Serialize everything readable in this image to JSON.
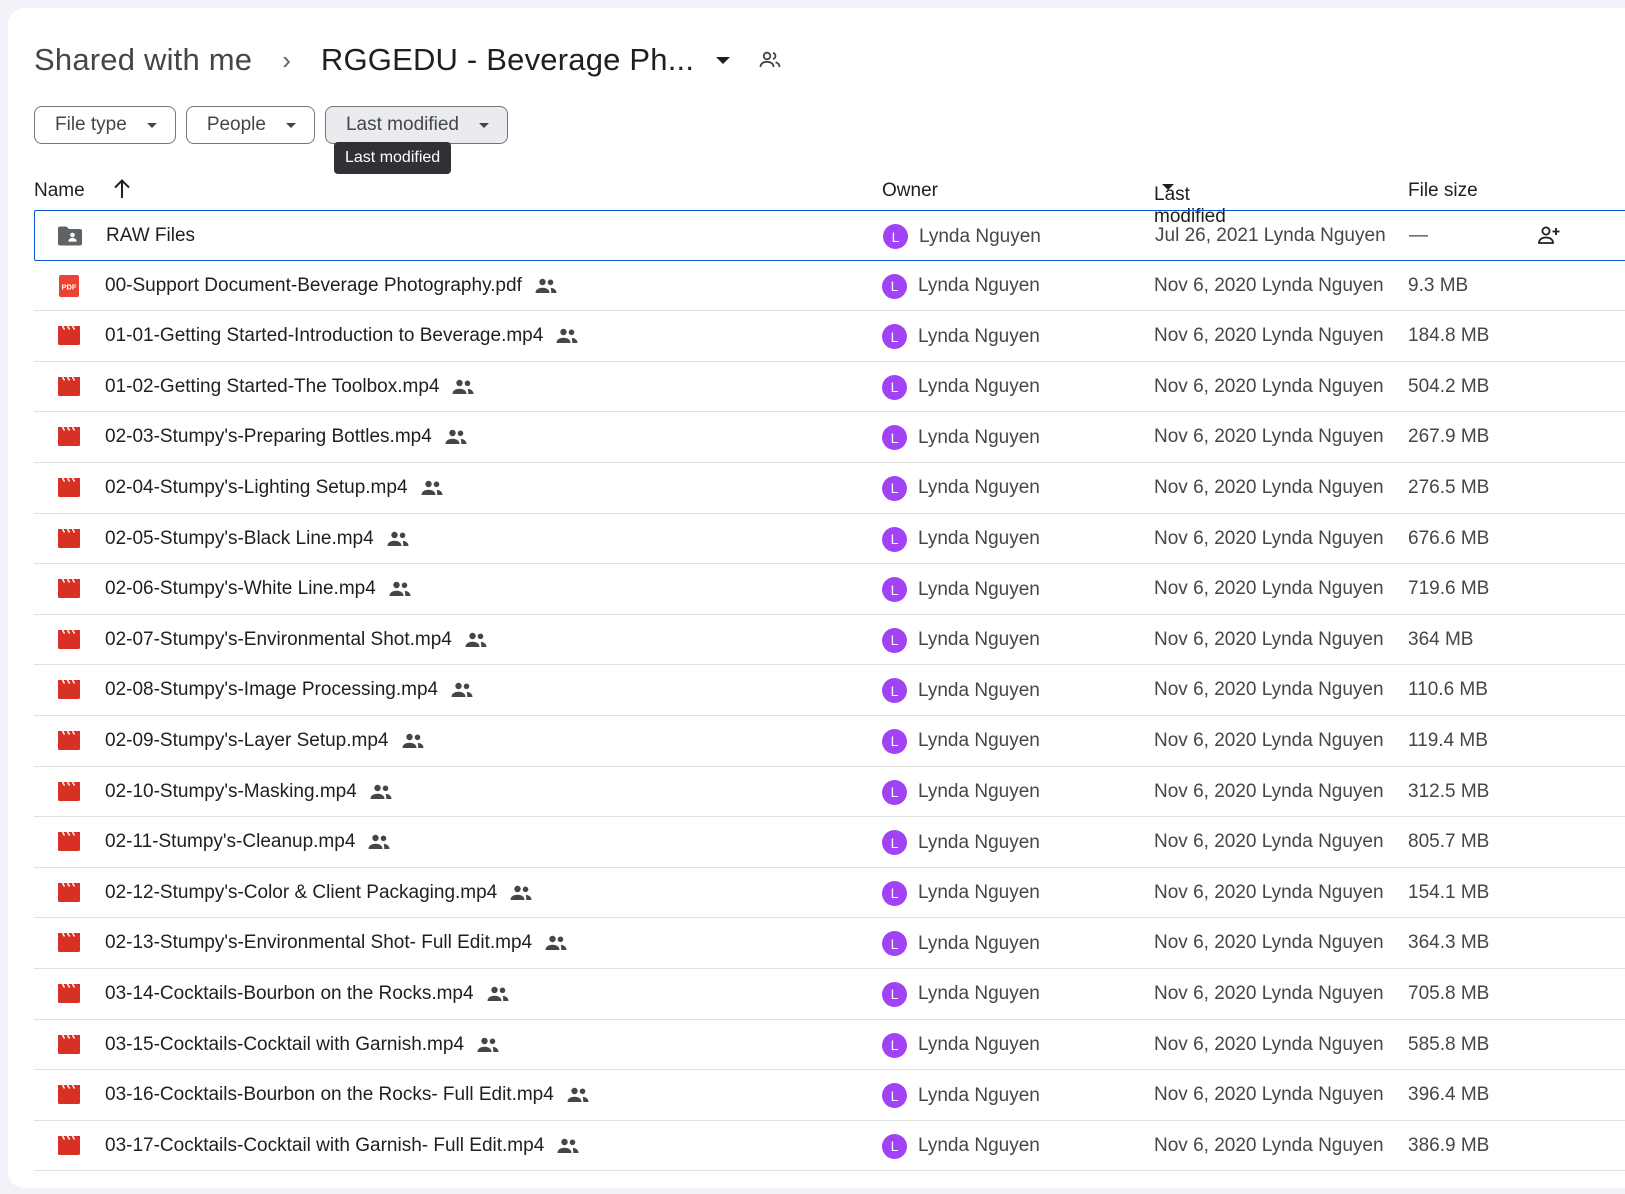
{
  "breadcrumb": {
    "root": "Shared with me",
    "separator": "›",
    "current": "RGGEDU - Beverage Ph..."
  },
  "filters": {
    "file_type": "File type",
    "people": "People",
    "last_modified": "Last modified"
  },
  "tooltip": "Last modified",
  "columns": {
    "name": "Name",
    "owner": "Owner",
    "last_modified": "Last modified",
    "file_size": "File size"
  },
  "colors": {
    "accent": "#0b57d0",
    "avatar": "#a142f4",
    "video": "#d93025",
    "pdf": "#ea4335"
  },
  "files": [
    {
      "name": "RAW Files",
      "type": "folder-icon",
      "shared": false,
      "owner": "Lynda Nguyen",
      "avatar": "L",
      "modified": "Jul 26, 2021 Lynda Nguyen",
      "size": "—",
      "selected": true
    },
    {
      "name": "00-Support Document-Beverage Photography.pdf",
      "type": "pdf-icon",
      "shared": true,
      "owner": "Lynda Nguyen",
      "avatar": "L",
      "modified": "Nov 6, 2020 Lynda Nguyen",
      "size": "9.3 MB"
    },
    {
      "name": "01-01-Getting Started-Introduction to Beverage.mp4",
      "type": "video-icon",
      "shared": true,
      "owner": "Lynda Nguyen",
      "avatar": "L",
      "modified": "Nov 6, 2020 Lynda Nguyen",
      "size": "184.8 MB"
    },
    {
      "name": "01-02-Getting Started-The Toolbox.mp4",
      "type": "video-icon",
      "shared": true,
      "owner": "Lynda Nguyen",
      "avatar": "L",
      "modified": "Nov 6, 2020 Lynda Nguyen",
      "size": "504.2 MB"
    },
    {
      "name": "02-03-Stumpy's-Preparing Bottles.mp4",
      "type": "video-icon",
      "shared": true,
      "owner": "Lynda Nguyen",
      "avatar": "L",
      "modified": "Nov 6, 2020 Lynda Nguyen",
      "size": "267.9 MB"
    },
    {
      "name": "02-04-Stumpy's-Lighting Setup.mp4",
      "type": "video-icon",
      "shared": true,
      "owner": "Lynda Nguyen",
      "avatar": "L",
      "modified": "Nov 6, 2020 Lynda Nguyen",
      "size": "276.5 MB"
    },
    {
      "name": "02-05-Stumpy's-Black Line.mp4",
      "type": "video-icon",
      "shared": true,
      "owner": "Lynda Nguyen",
      "avatar": "L",
      "modified": "Nov 6, 2020 Lynda Nguyen",
      "size": "676.6 MB"
    },
    {
      "name": "02-06-Stumpy's-White Line.mp4",
      "type": "video-icon",
      "shared": true,
      "owner": "Lynda Nguyen",
      "avatar": "L",
      "modified": "Nov 6, 2020 Lynda Nguyen",
      "size": "719.6 MB"
    },
    {
      "name": "02-07-Stumpy's-Environmental Shot.mp4",
      "type": "video-icon",
      "shared": true,
      "owner": "Lynda Nguyen",
      "avatar": "L",
      "modified": "Nov 6, 2020 Lynda Nguyen",
      "size": "364 MB"
    },
    {
      "name": "02-08-Stumpy's-Image Processing.mp4",
      "type": "video-icon",
      "shared": true,
      "owner": "Lynda Nguyen",
      "avatar": "L",
      "modified": "Nov 6, 2020 Lynda Nguyen",
      "size": "110.6 MB"
    },
    {
      "name": "02-09-Stumpy's-Layer Setup.mp4",
      "type": "video-icon",
      "shared": true,
      "owner": "Lynda Nguyen",
      "avatar": "L",
      "modified": "Nov 6, 2020 Lynda Nguyen",
      "size": "119.4 MB"
    },
    {
      "name": "02-10-Stumpy's-Masking.mp4",
      "type": "video-icon",
      "shared": true,
      "owner": "Lynda Nguyen",
      "avatar": "L",
      "modified": "Nov 6, 2020 Lynda Nguyen",
      "size": "312.5 MB"
    },
    {
      "name": "02-11-Stumpy's-Cleanup.mp4",
      "type": "video-icon",
      "shared": true,
      "owner": "Lynda Nguyen",
      "avatar": "L",
      "modified": "Nov 6, 2020 Lynda Nguyen",
      "size": "805.7 MB"
    },
    {
      "name": "02-12-Stumpy's-Color & Client Packaging.mp4",
      "type": "video-icon",
      "shared": true,
      "owner": "Lynda Nguyen",
      "avatar": "L",
      "modified": "Nov 6, 2020 Lynda Nguyen",
      "size": "154.1 MB"
    },
    {
      "name": "02-13-Stumpy's-Environmental Shot- Full Edit.mp4",
      "type": "video-icon",
      "shared": true,
      "owner": "Lynda Nguyen",
      "avatar": "L",
      "modified": "Nov 6, 2020 Lynda Nguyen",
      "size": "364.3 MB"
    },
    {
      "name": "03-14-Cocktails-Bourbon on the Rocks.mp4",
      "type": "video-icon",
      "shared": true,
      "owner": "Lynda Nguyen",
      "avatar": "L",
      "modified": "Nov 6, 2020 Lynda Nguyen",
      "size": "705.8 MB"
    },
    {
      "name": "03-15-Cocktails-Cocktail with Garnish.mp4",
      "type": "video-icon",
      "shared": true,
      "owner": "Lynda Nguyen",
      "avatar": "L",
      "modified": "Nov 6, 2020 Lynda Nguyen",
      "size": "585.8 MB"
    },
    {
      "name": "03-16-Cocktails-Bourbon on the Rocks- Full Edit.mp4",
      "type": "video-icon",
      "shared": true,
      "owner": "Lynda Nguyen",
      "avatar": "L",
      "modified": "Nov 6, 2020 Lynda Nguyen",
      "size": "396.4 MB"
    },
    {
      "name": "03-17-Cocktails-Cocktail with Garnish- Full Edit.mp4",
      "type": "video-icon",
      "shared": true,
      "owner": "Lynda Nguyen",
      "avatar": "L",
      "modified": "Nov 6, 2020 Lynda Nguyen",
      "size": "386.9 MB"
    }
  ]
}
